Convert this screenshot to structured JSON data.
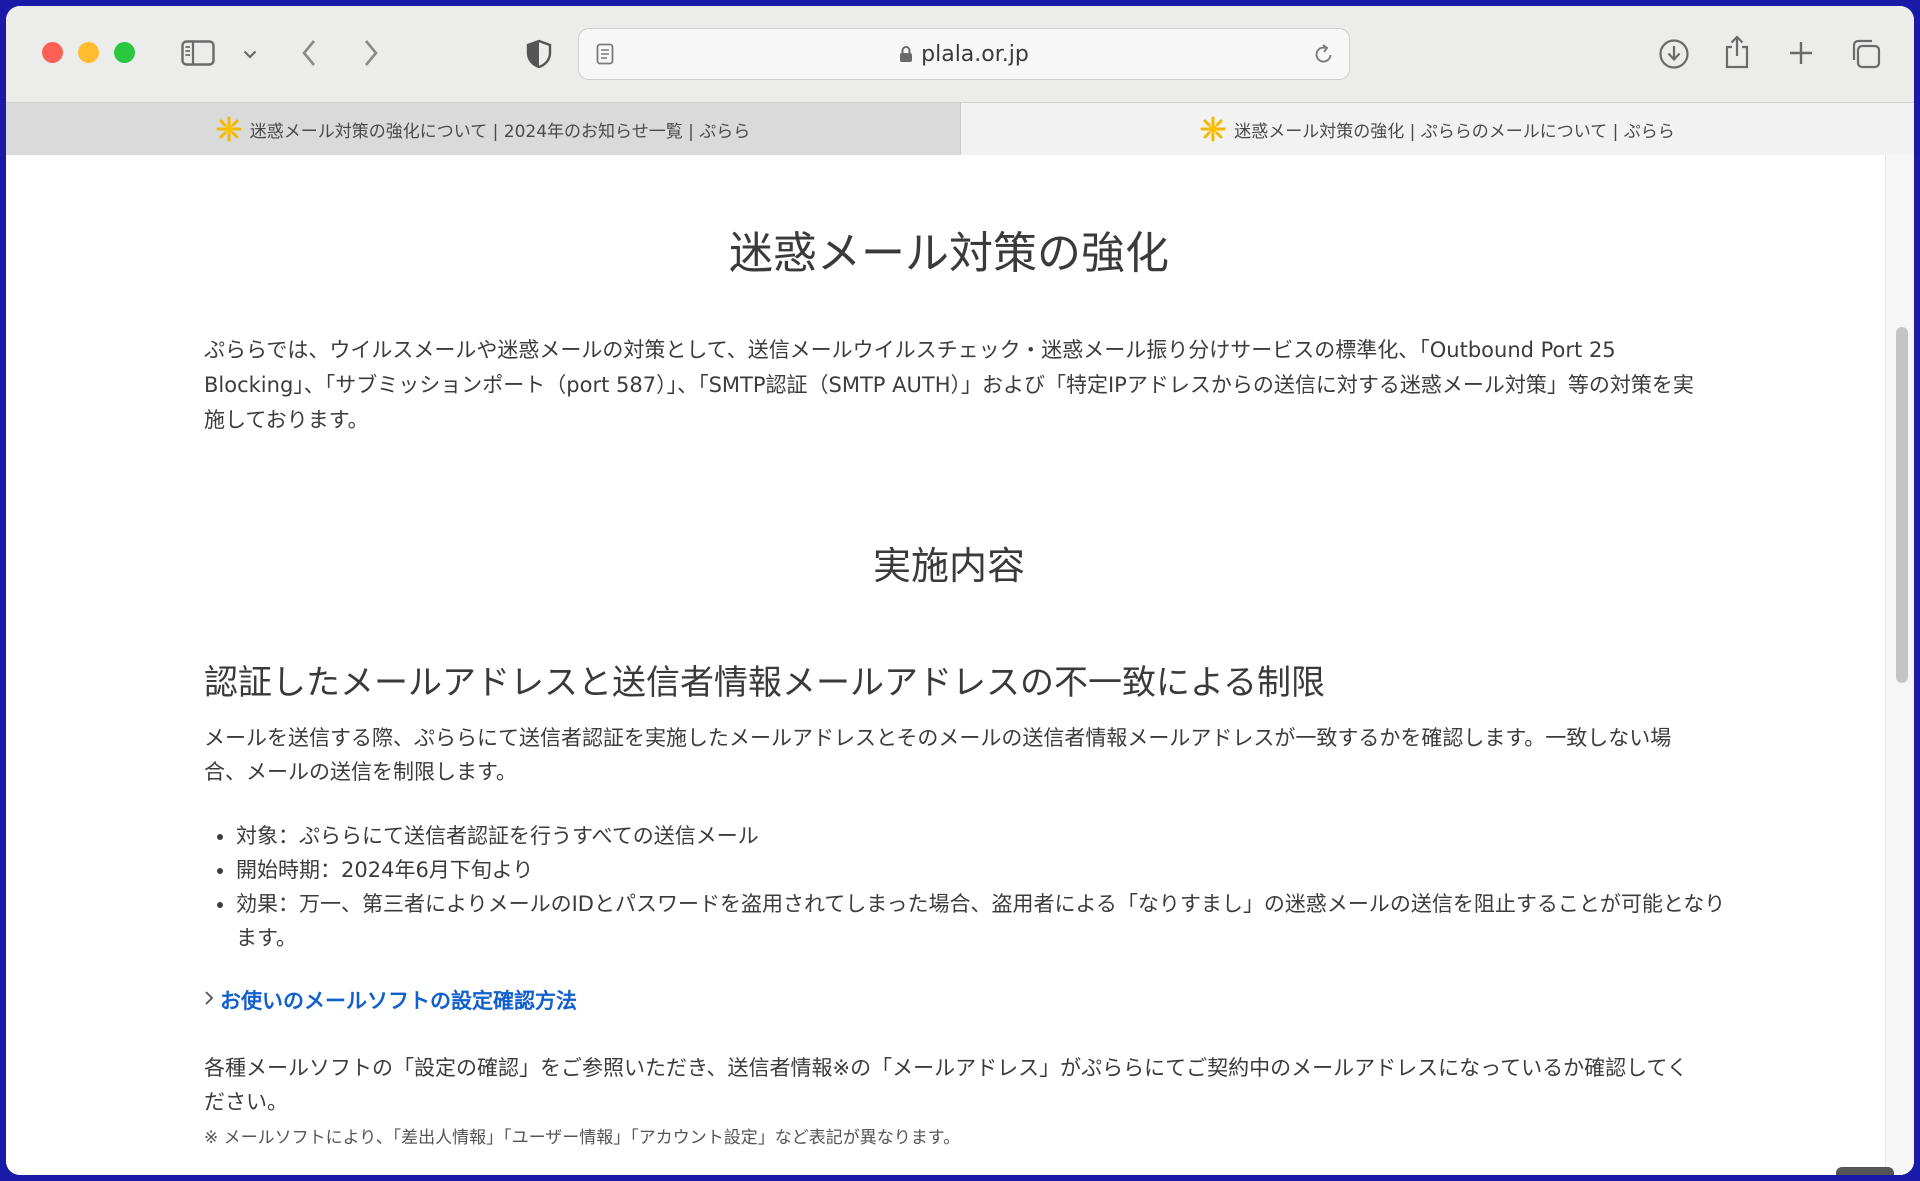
{
  "browser": {
    "url": "plala.or.jp",
    "icons": {
      "sidebar": "sidebar-icon",
      "chevron": "chevron-down-icon",
      "back": "back-icon",
      "forward": "forward-icon",
      "shield": "shield-icon",
      "reader": "reader-icon",
      "lock": "lock-icon",
      "reload": "reload-icon",
      "download": "download-icon",
      "share": "share-icon",
      "new_tab": "plus-icon",
      "tabs": "tabs-overview-icon"
    }
  },
  "tabs": [
    {
      "title": "迷惑メール対策の強化について | 2024年のお知らせ一覧 | ぷらら"
    },
    {
      "title": "迷惑メール対策の強化 | ぷららのメールについて | ぷらら"
    }
  ],
  "page": {
    "title": "迷惑メール対策の強化",
    "intro": "ぷららでは、ウイルスメールや迷惑メールの対策として、送信メールウイルスチェック・迷惑メール振り分けサービスの標準化、「Outbound Port 25 Blocking」、「サブミッションポート（port 587）」、「SMTP認証（SMTP AUTH）」および「特定IPアドレスからの送信に対する迷惑メール対策」等の対策を実施しております。",
    "section_heading": "実施内容",
    "sub_heading": "認証したメールアドレスと送信者情報メールアドレスの不一致による制限",
    "description": "メールを送信する際、ぷららにて送信者認証を実施したメールアドレスとそのメールの送信者情報メールアドレスが一致するかを確認します。一致しない場合、メールの送信を制限します。",
    "list": [
      "対象：ぷららにて送信者認証を行うすべての送信メール",
      "開始時期：2024年6月下旬より",
      "効果：万一、第三者によりメールのIDとパスワードを盗用されてしまった場合、盗用者による「なりすまし」の迷惑メールの送信を阻止することが可能となります。"
    ],
    "link_text": "お使いのメールソフトの設定確認方法",
    "check_text": "各種メールソフトの「設定の確認」をご参照いただき、送信者情報※の「メールアドレス」がぷららにてご契約中のメールアドレスになっているか確認してください。",
    "note": "※ メールソフトにより、「差出人情報」「ユーザー情報」「アカウント設定」など表記が異なります。"
  }
}
